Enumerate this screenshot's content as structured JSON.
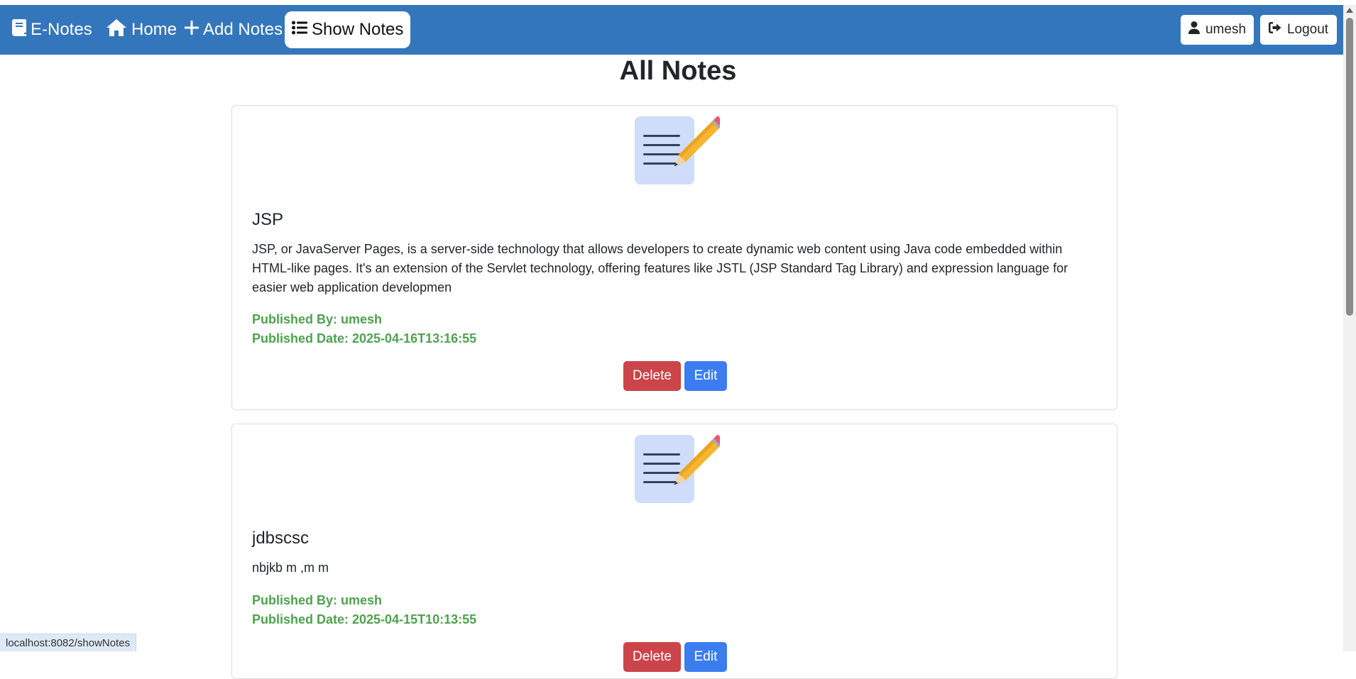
{
  "navbar": {
    "brand": "E-Notes",
    "home": "Home",
    "add_notes": "Add Notes",
    "show_notes": "Show Notes",
    "user": "umesh",
    "logout": "Logout",
    "bg_color": "#3476bb",
    "icons": {
      "brand": "book-icon",
      "home": "home-icon",
      "add_notes": "plus-icon",
      "show_notes": "list-icon",
      "user": "user-icon",
      "logout": "logout-icon"
    }
  },
  "main": {
    "title": "All Notes",
    "notes": [
      {
        "icon": "note-pencil-icon",
        "title": "JSP",
        "content": "JSP, or JavaServer Pages, is a server-side technology that allows developers to create dynamic web content using Java code embedded within HTML-like pages. It's an extension of the Servlet technology, offering features like JSTL (JSP Standard Tag Library) and expression language for easier web application developmen",
        "published_by": "Published By: umesh",
        "published_date": "Published Date: 2025-04-16T13:16:55",
        "delete_label": "Delete",
        "edit_label": "Edit"
      },
      {
        "icon": "note-pencil-icon",
        "title": "jdbscsc",
        "content": "nbjkb m ,m m",
        "published_by": "Published By: umesh",
        "published_date": "Published Date: 2025-04-15T10:13:55",
        "delete_label": "Delete",
        "edit_label": "Edit"
      }
    ]
  },
  "status_bar": {
    "url": "localhost:8082/showNotes"
  },
  "colors": {
    "meta_green": "#4ea24e",
    "delete_red": "#cb444a",
    "edit_blue": "#3b7df0"
  }
}
